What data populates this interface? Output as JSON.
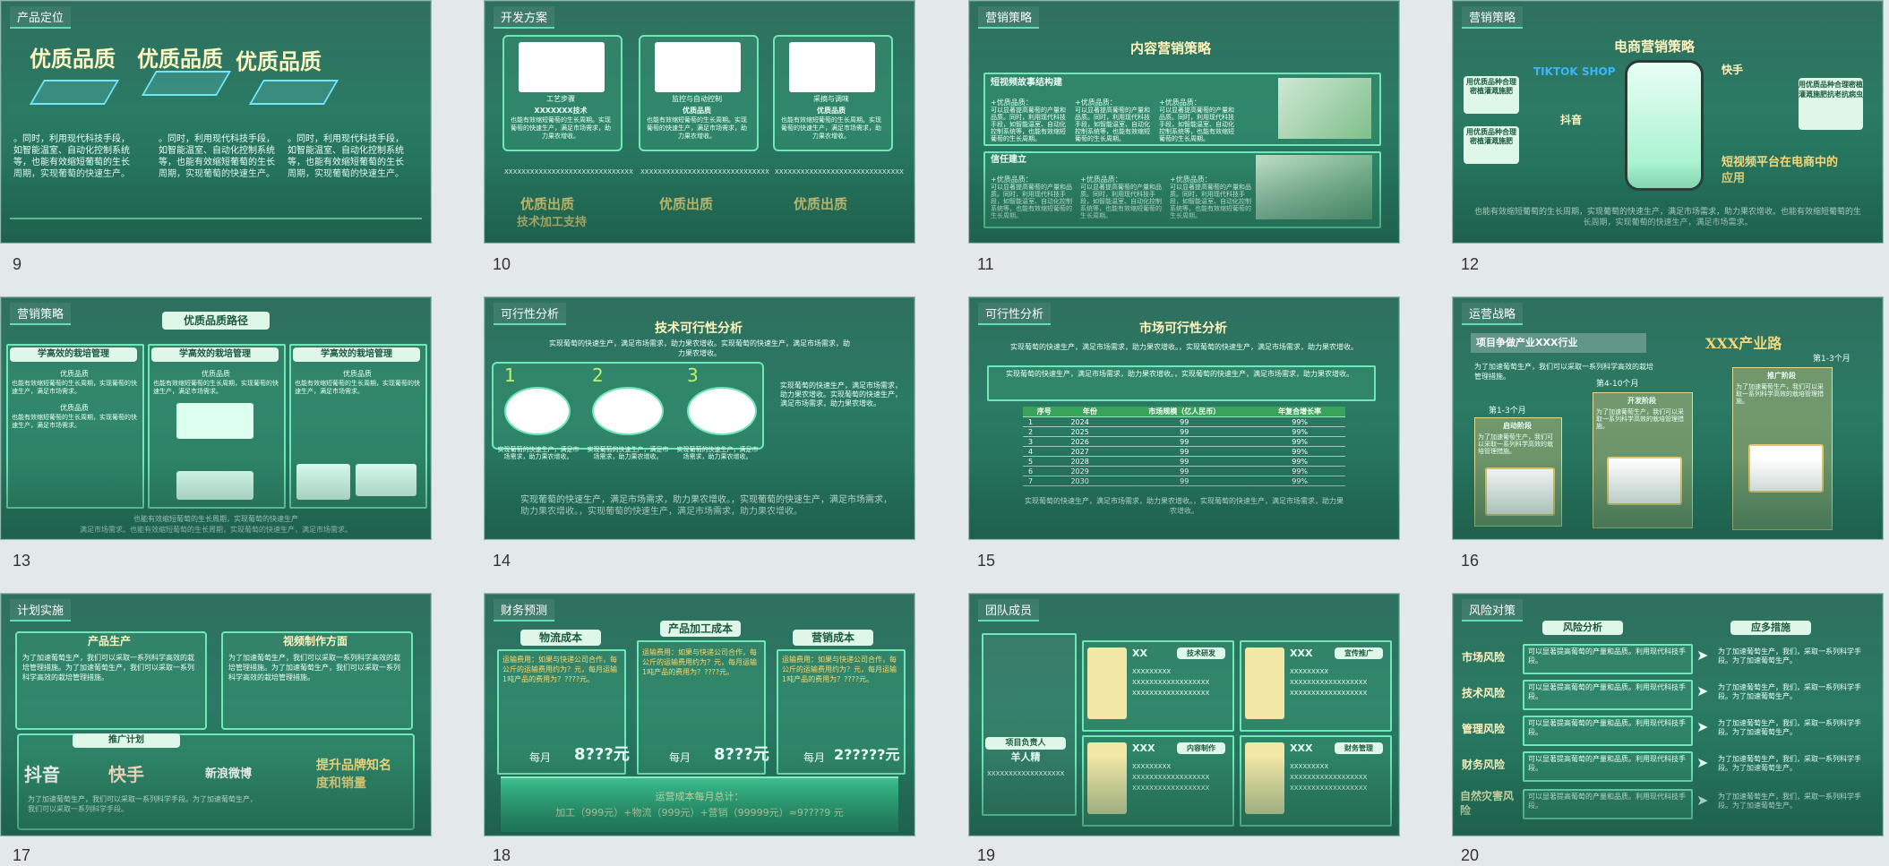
{
  "slides": [
    {
      "number": "9",
      "tag": "产品定位",
      "titles": [
        "优质品质",
        "优质品质",
        "优质品质"
      ],
      "body": "。同时，利用现代科技手段，如智能温室、自动化控制系统等，也能有效缩短葡萄的生长周期，实现葡萄的快速生产。"
    },
    {
      "number": "10",
      "tag": "开发方案",
      "cards": [
        {
          "label": "工艺步骤",
          "title": "XXXXXXX技术"
        },
        {
          "label": "监控与自动控制",
          "title": "优质品质"
        },
        {
          "label": "采摘与调味",
          "title": "优质品质"
        }
      ],
      "card_text": "也能有效缩短葡萄的生长周期。实现葡萄的快速生产，满足市场需求，助力果农增收。",
      "xs": "XXXXXXXXXXXXXXXXXXXXXXXXXXXXXX",
      "bottom": [
        "优质出质",
        "优质出质",
        "优质出质"
      ],
      "bottom_sub": "技术加工支持"
    },
    {
      "number": "11",
      "tag": "营销策略",
      "title": "内容营销策略",
      "section1": "短视频故事结构建",
      "section2": "信任建立",
      "item": "+优质品质：",
      "item_text": "可以显著提高葡萄的产量和品质。同时，利用现代科技手段，如智能温室、自动化控制系统等，也能有效缩短葡萄的生长周期。"
    },
    {
      "number": "12",
      "tag": "营销策略",
      "title": "电商营销策略",
      "tiktok": "TIKTOK SHOP",
      "kuaishou": "快手",
      "douyin": "抖音",
      "left_boxes": [
        "用优质品种合理密植灌溉施肥",
        "用优质品种合理密植灌溉施肥"
      ],
      "right_box": "用优质品种合理密植灌溉施肥抗老抗病虫",
      "slogan": "短视频平台在电商中的应用",
      "bottom": "也能有效缩短葡萄的生长周期，实现葡萄的快速生产，满足市场需求，助力果农增收。也能有效缩短葡萄的生长周期，实现葡萄的快速生产，满足市场需求。"
    },
    {
      "number": "13",
      "tag": "营销策略",
      "title": "优质品质路径",
      "cols": [
        "学高效的栽培管理",
        "学高效的栽培管理",
        "学高效的栽培管理"
      ],
      "sub": "优质品质",
      "text": "也能有效缩短葡萄的生长周期，实现葡萄的快速生产，满足市场需求。",
      "bottom": "也能有效缩短葡萄的生长周期，实现葡萄的快速生产",
      "bottom2": "满足市场需求。也能有效缩短葡萄的生长周期，实现葡萄的快速生产，满足市场需求。"
    },
    {
      "number": "14",
      "tag": "可行性分析",
      "title": "技术可行性分析",
      "intro": "实现葡萄的快速生产，满足市场需求，助力果农增收。实现葡萄的快速生产，满足市场需求，助力果农增收。",
      "steps": [
        "1",
        "2",
        "3"
      ],
      "step_text": "实现葡萄的快速生产，满足市场需求，助力果农增收。",
      "right": "实现葡萄的快速生产，满足市场需求，助力果农增收。实现葡萄的快速生产，满足市场需求，助力果农增收。",
      "bottom": "实现葡萄的快速生产，满足市场需求，助力果农增收。，实现葡萄的快速生产，满足市场需求，助力果农增收。，实现葡萄的快速生产，满足市场需求，助力果农增收。"
    },
    {
      "number": "15",
      "tag": "可行性分析",
      "title": "市场可行性分析",
      "intro": "实现葡萄的快速生产，满足市场需求，助力果农增收。，实现葡萄的快速生产，满足市场需求，助力果农增收。",
      "box": "实现葡萄的快速生产，满足市场需求，助力果农增收。，实现葡萄的快速生产，满足市场需求，助力果农增收。",
      "table": {
        "headers": [
          "序号",
          "年份",
          "市场规模（亿人民币）",
          "年复合增长率"
        ],
        "rows": [
          [
            "1",
            "2024",
            "99",
            "99%"
          ],
          [
            "2",
            "2025",
            "99",
            "99%"
          ],
          [
            "3",
            "2026",
            "99",
            "99%"
          ],
          [
            "4",
            "2027",
            "99",
            "99%"
          ],
          [
            "5",
            "2028",
            "99",
            "99%"
          ],
          [
            "6",
            "2029",
            "99",
            "99%"
          ],
          [
            "7",
            "2030",
            "99",
            "99%"
          ]
        ]
      },
      "bottom": "实现葡萄的快速生产，满足市场需求，助力果农增收。，实现葡萄的快速生产，满足市场需求，助力果农增收。"
    },
    {
      "number": "16",
      "tag": "运营战略",
      "title": "项目争做产业XXX行业",
      "title2": "XXX产业路",
      "intro": "为了加速葡萄生产，我们可以采取一系列科学高效的栽培管理措施。",
      "stages": [
        "启动阶段",
        "开发阶段",
        "推广阶段"
      ],
      "periods": [
        "第1-3个月",
        "第4-10个月",
        "第1-3个月"
      ],
      "stage_text": "为了加速葡萄生产，我们可以采取一系列科学高效的栽培管理措施。"
    },
    {
      "number": "17",
      "tag": "计划实施",
      "box1": "产品生产",
      "box2": "视频制作方面",
      "box_text": "为了加速葡萄生产，我们可以采取一系列科学高效的栽培管理措施。为了加速葡萄生产，我们可以采取一系列科学高效的栽培管理措施。",
      "promo": "推广计划",
      "logos": [
        "抖音",
        "快手",
        "新浪微博"
      ],
      "slogan": "提升品牌知名度和销量",
      "bottom": "为了加速葡萄生产，我们可以采取一系列科学手段。为了加速葡萄生产，我们可以采取一系列科学手段。"
    },
    {
      "number": "18",
      "tag": "财务预测",
      "cols": [
        "物流成本",
        "产品加工成本",
        "营销成本"
      ],
      "monthly": "每月",
      "amount": "8???元",
      "amount3": "2?????元",
      "col_text": "运输费用：如果与快递公司合作，每公斤的运输费用约为？元，每月运输1吨产品的费用为？????元。",
      "footer_title": "运营成本每月总计：",
      "footer": "加工（999元）+物流（999元）+营销（99999元）≈9????9 元"
    },
    {
      "number": "19",
      "tag": "团队成员",
      "leader": "项目负责人",
      "leader_name": "羊人精",
      "members": [
        {
          "name": "XX",
          "role": "技术研发"
        },
        {
          "name": "XXX",
          "role": "宣传推广"
        },
        {
          "name": "XXX",
          "role": "内容制作"
        },
        {
          "name": "XXX",
          "role": "财务管理"
        }
      ],
      "lines": [
        "XXXXXXXXX",
        "XXXXXXXXXXXXXXXXXX",
        "XXXXXXXXXXXXXXXXXX"
      ]
    },
    {
      "number": "20",
      "tag": "风险对策",
      "h1": "风险分析",
      "h2": "应多措施",
      "risks": [
        "市场风险",
        "技术风险",
        "管理风险",
        "财务风险",
        "自然灾害风险"
      ],
      "analysis": "可以显著提高葡萄的产量和品质。利用现代科技手段。",
      "measure": "为了加速葡萄生产，我们，采取一系列科学手段。为了加速葡萄生产。"
    }
  ]
}
